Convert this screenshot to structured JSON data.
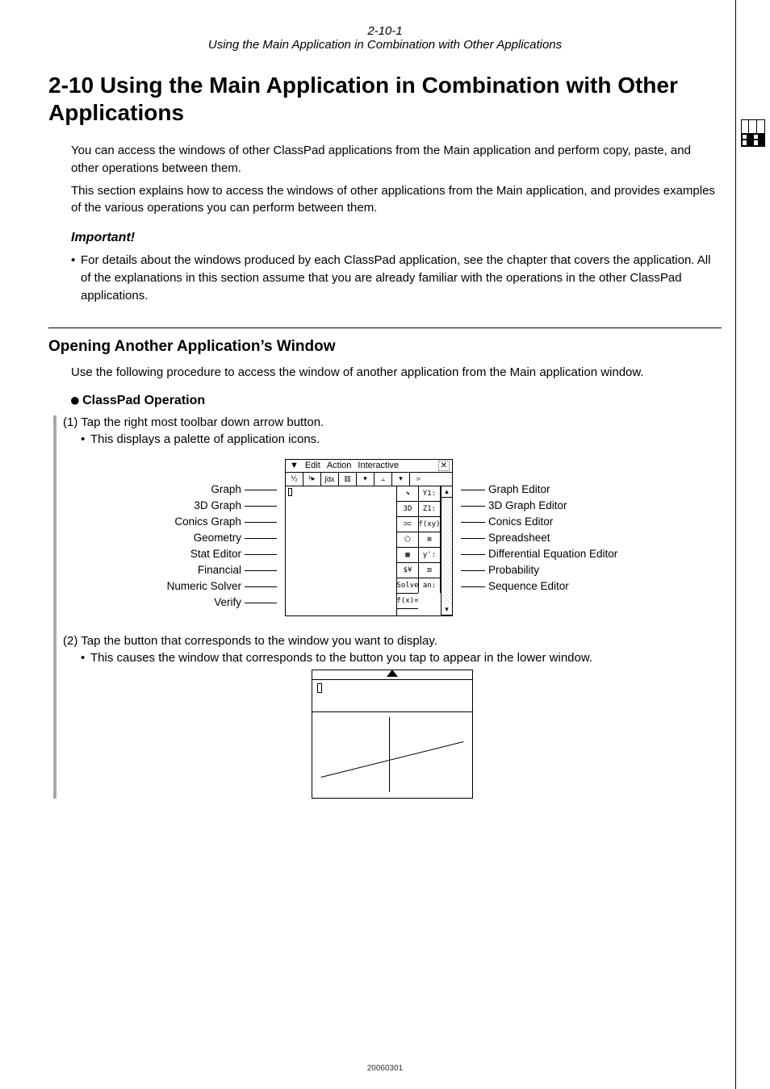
{
  "header": {
    "num": "2-10-1",
    "sub": "Using the Main Application in Combination with Other Applications"
  },
  "title_prefix": "2-10",
  "title_rest": "Using the Main Application in Combination with Other Applications",
  "intro": {
    "p1": "You can access the windows of other ClassPad applications from the Main application and perform copy, paste, and other operations between them.",
    "p2": "This section explains how to access the windows of other applications from the Main application, and provides examples of the various operations you can perform between them."
  },
  "important_label": "Important!",
  "important_bullet": "For details about the windows produced by each ClassPad application, see the chapter that covers the application. All of the explanations in this section assume that you are already familiar with the operations in the other ClassPad applications.",
  "subhead": "Opening Another Application’s Window",
  "sub_intro": "Use the following procedure to access the window of another application from the Main application window.",
  "op_label": "ClassPad Operation",
  "step1": "(1) Tap the right most toolbar down arrow button.",
  "step1_sub": "This displays a palette of application icons.",
  "menubar": {
    "logo": "▼",
    "m1": "Edit",
    "m2": "Action",
    "m3": "Interactive",
    "close": "✕"
  },
  "labels_left": [
    "Graph",
    "3D Graph",
    "Conics Graph",
    "Geometry",
    "Stat Editor",
    "Financial",
    "Numeric Solver",
    "Verify"
  ],
  "labels_right": [
    "Graph Editor",
    "3D Graph Editor",
    "Conics Editor",
    "Spreadsheet",
    "Differential Equation Editor",
    "Probability",
    "Sequence Editor"
  ],
  "step2": "(2) Tap the button that corresponds to the window you want to display.",
  "step2_sub": "This causes the window that corresponds to the button you tap to appear in the lower window.",
  "footer": "20060301"
}
